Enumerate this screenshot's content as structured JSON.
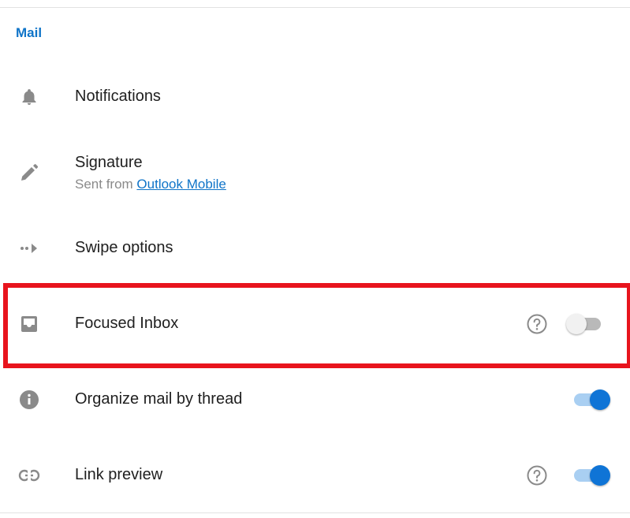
{
  "section": {
    "title": "Mail",
    "accent": "#0f74c8"
  },
  "items": [
    {
      "icon": "bell-icon",
      "title": "Notifications"
    },
    {
      "icon": "pen-icon",
      "title": "Signature",
      "subtitle_prefix": "Sent from ",
      "subtitle_link": "Outlook Mobile"
    },
    {
      "icon": "swipe-arrow-icon",
      "title": "Swipe options"
    },
    {
      "icon": "inbox-tray-icon",
      "title": "Focused Inbox",
      "has_help": true,
      "toggle_on": false
    },
    {
      "icon": "info-icon",
      "title": "Organize mail by thread",
      "has_help": false,
      "toggle_on": true
    },
    {
      "icon": "link-icon",
      "title": "Link preview",
      "has_help": true,
      "toggle_on": true
    }
  ],
  "highlight": {
    "color": "#e8141d",
    "target": "Focused Inbox"
  },
  "colors": {
    "toggle_on": "#0f74d6",
    "toggle_on_track": "#a9cff2",
    "toggle_off_track": "#b9b9b9",
    "icon_gray": "#8a8a8a"
  }
}
